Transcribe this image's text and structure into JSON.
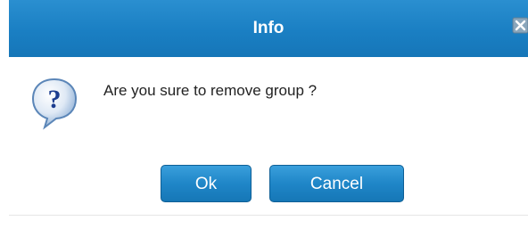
{
  "dialog": {
    "title": "Info",
    "message": "Are you sure to remove group ?",
    "icon": "question-icon",
    "close_icon": "close-icon",
    "buttons": {
      "ok_label": "Ok",
      "cancel_label": "Cancel"
    }
  },
  "colors": {
    "titlebar": "#1a7fc3",
    "button": "#1f86c8",
    "title_text": "#ffffff"
  }
}
